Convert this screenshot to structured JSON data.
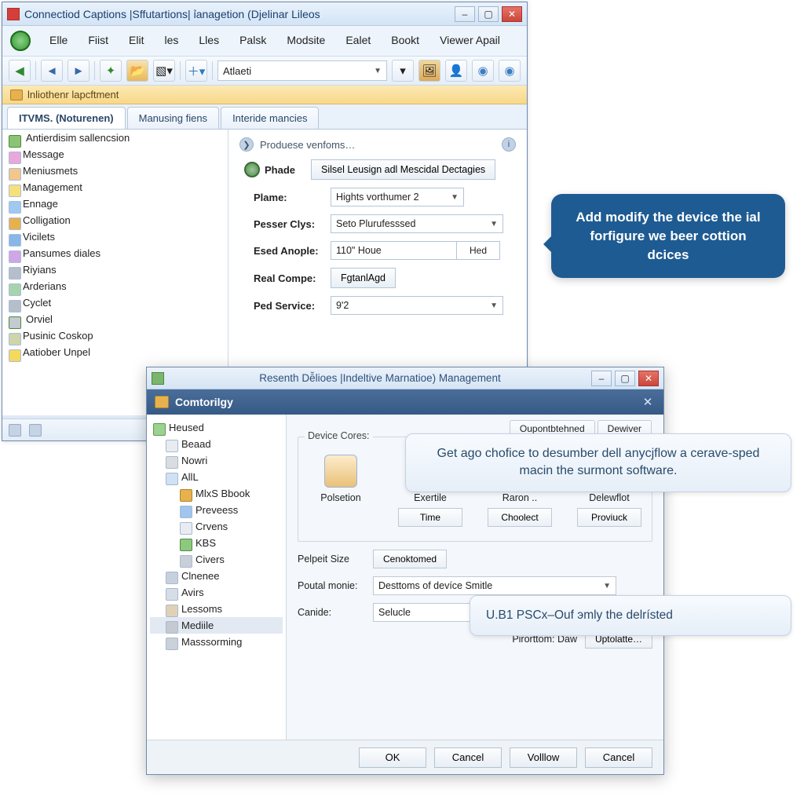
{
  "back_window": {
    "title": "Connectiod Captions |Sffutartions| ỉanagetion (Djelinar Lileos",
    "menu": [
      "Elle",
      "Fiist",
      "Elit",
      "les",
      "Lles",
      "Palsk",
      "Modsite",
      "Ealet",
      "Bookt",
      "Viewer Apail"
    ],
    "toolbar_combo": "Atlaeti",
    "bandbar": "lnliothenr lapcftment",
    "tabs": [
      "ITVMS. (Noturenen)",
      "Manusing fiens",
      "Interide mancies"
    ],
    "tree": {
      "root": "Antierdisim sallencsion",
      "items": [
        "Message",
        "Meniusmets",
        "Management",
        "Ennage",
        "Colligation",
        "Vicilets",
        "Pansumes diales",
        "Riyians",
        "Arderians",
        "Cyclet",
        "Orviel",
        "Pusinic Coskop",
        "Aatiober Unpel"
      ]
    },
    "form": {
      "header": "Produese venfoms…",
      "phade_label": "Phade",
      "phade_button": "Silsel Leusign adl Mescidal Dectagies",
      "rows": {
        "plame": {
          "label": "Plame:",
          "value": "Hights vorthumer 2"
        },
        "pesser": {
          "label": "Pesser Clys:",
          "value": "Seto Plurufesssed"
        },
        "esed": {
          "label": "Esed Anople:",
          "value": "110\" Houe",
          "unit": "Hed"
        },
        "real": {
          "label": "Real Compe:",
          "button": "FgtanlAgd"
        },
        "ped": {
          "label": "Ped Service:",
          "value": "9'2"
        }
      }
    }
  },
  "front_window": {
    "title": "Resenth Dễlioes |Indeltive Marnatioe) Management",
    "band": "Comtorilgy",
    "tree": {
      "root": "Heused",
      "items": [
        {
          "lbl": "Beaad",
          "cls": "i-box"
        },
        {
          "lbl": "Nowri",
          "cls": "i-clock"
        },
        {
          "lbl": "AllL",
          "cls": "i-doc"
        },
        {
          "lbl": "MlxS Bbook",
          "cls": "lv2 i-folder"
        },
        {
          "lbl": "Preveess",
          "cls": "lv2 i-blue"
        },
        {
          "lbl": "Crvens",
          "cls": "lv2 i-box"
        },
        {
          "lbl": "KBS",
          "cls": "lv2 i-green"
        },
        {
          "lbl": "Civers",
          "cls": "lv2 i-star"
        },
        {
          "lbl": "Clnenee",
          "cls": "lv1 i-pc"
        },
        {
          "lbl": "Avirs",
          "cls": "lv1 i-arrow"
        },
        {
          "lbl": "Lessoms",
          "cls": "lv1 i-book"
        },
        {
          "lbl": "Mediile",
          "cls": "lv1 i-block sel"
        },
        {
          "lbl": "Masssorming",
          "cls": "lv1 i-gear"
        }
      ]
    },
    "group_legend": "Device Cores:",
    "mini_tabs": [
      "Oupontbtehned",
      "Dewiver"
    ],
    "icons": {
      "home": {
        "lbl": "Polsetion"
      },
      "exe": {
        "lbl": "Exertile",
        "btn": "Time"
      },
      "rar": {
        "lbl": "Raron  ..",
        "btn": "Choolect"
      },
      "del": {
        "lbl": "Delewflot",
        "btn": "Proviuck"
      }
    },
    "pelpeit_label": "Pelpeit Size",
    "pelpeit_btn": "Cenoktomed",
    "poutal_label": "Poutal monie:",
    "poutal_value": "Desttoms of devíce Smitle",
    "canide_label": "Canide:",
    "canide_value": "Selucle",
    "priort_label": "Pirorttom: Daw",
    "priort_btn": "Uptolatte…",
    "buttons": [
      "OK",
      "Cancel",
      "Volllow",
      "Cancel"
    ]
  },
  "callouts": {
    "c1": "Add modify the device the ial forfigure we beer cottion dcices",
    "c2": "Get ago chofice to desumber dell anycjflow a cerave-sped macin the surmont software.",
    "c3": "U.B1 PSCx–Ouf эmly the delrísted"
  }
}
